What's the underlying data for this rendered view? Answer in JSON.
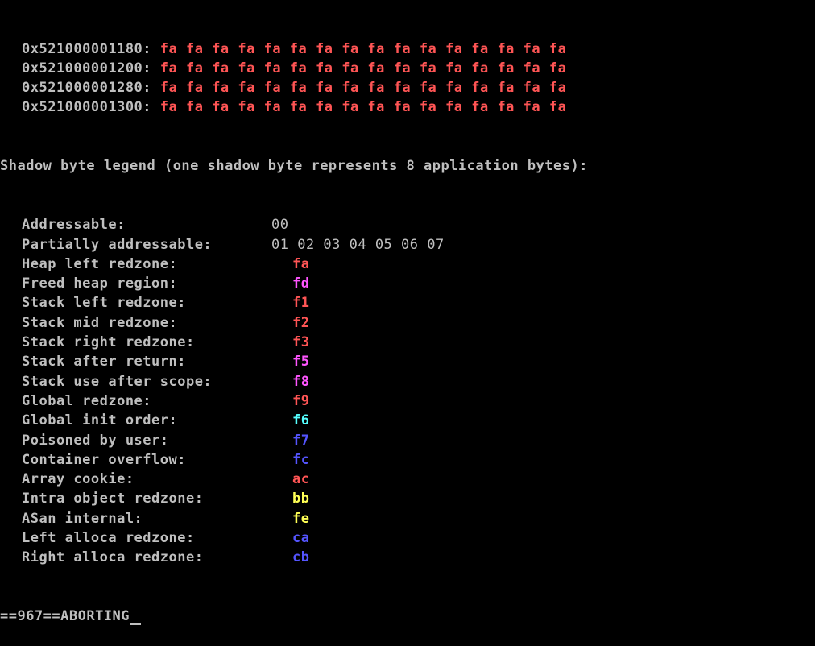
{
  "colors": {
    "background": "#000000",
    "text": "#bfbfbf",
    "red": "#ff5555",
    "magenta": "#ff55ff",
    "cyan": "#55ffff",
    "blue": "#5555ff",
    "yellow": "#ffff55"
  },
  "shadow_rows": [
    {
      "address": "0x521000001180:",
      "bytes": "fa fa fa fa fa fa fa fa fa fa fa fa fa fa fa fa"
    },
    {
      "address": "0x521000001200:",
      "bytes": "fa fa fa fa fa fa fa fa fa fa fa fa fa fa fa fa"
    },
    {
      "address": "0x521000001280:",
      "bytes": "fa fa fa fa fa fa fa fa fa fa fa fa fa fa fa fa"
    },
    {
      "address": "0x521000001300:",
      "bytes": "fa fa fa fa fa fa fa fa fa fa fa fa fa fa fa fa"
    }
  ],
  "legend_header": "Shadow byte legend (one shadow byte represents 8 application bytes):",
  "legend": [
    {
      "label": "Addressable:",
      "code": "00",
      "color": "#bfbfbf"
    },
    {
      "label": "Partially addressable:",
      "code": "01 02 03 04 05 06 07",
      "color": "#bfbfbf"
    },
    {
      "label": "Heap left redzone:",
      "code": "fa",
      "color": "#ff5555"
    },
    {
      "label": "Freed heap region:",
      "code": "fd",
      "color": "#ff55ff"
    },
    {
      "label": "Stack left redzone:",
      "code": "f1",
      "color": "#ff5555"
    },
    {
      "label": "Stack mid redzone:",
      "code": "f2",
      "color": "#ff5555"
    },
    {
      "label": "Stack right redzone:",
      "code": "f3",
      "color": "#ff5555"
    },
    {
      "label": "Stack after return:",
      "code": "f5",
      "color": "#ff55ff"
    },
    {
      "label": "Stack use after scope:",
      "code": "f8",
      "color": "#ff55ff"
    },
    {
      "label": "Global redzone:",
      "code": "f9",
      "color": "#ff5555"
    },
    {
      "label": "Global init order:",
      "code": "f6",
      "color": "#55ffff"
    },
    {
      "label": "Poisoned by user:",
      "code": "f7",
      "color": "#5555ff"
    },
    {
      "label": "Container overflow:",
      "code": "fc",
      "color": "#5555ff"
    },
    {
      "label": "Array cookie:",
      "code": "ac",
      "color": "#ff5555"
    },
    {
      "label": "Intra object redzone:",
      "code": "bb",
      "color": "#ffff55"
    },
    {
      "label": "ASan internal:",
      "code": "fe",
      "color": "#ffff55"
    },
    {
      "label": "Left alloca redzone:",
      "code": "ca",
      "color": "#5555ff"
    },
    {
      "label": "Right alloca redzone:",
      "code": "cb",
      "color": "#5555ff"
    }
  ],
  "final_line": "==967==ABORTING"
}
